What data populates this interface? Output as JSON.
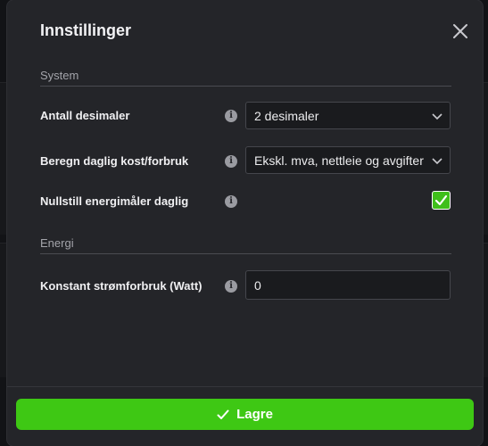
{
  "modal": {
    "title": "Innstillinger",
    "close_label": "×"
  },
  "sections": {
    "system": "System",
    "energy": "Energi"
  },
  "settings": {
    "decimals": {
      "label": "Antall desimaler",
      "value": "2 desimaler"
    },
    "daily_cost": {
      "label": "Beregn daglig kost/forbruk",
      "value": "Ekskl. mva, nettleie og avgifter"
    },
    "reset_meter": {
      "label": "Nullstill energimåler daglig",
      "checked": true
    },
    "constant_power": {
      "label": "Konstant strømforbruk (Watt)",
      "value": "0"
    }
  },
  "footer": {
    "save_label": "Lagre"
  },
  "icons": {
    "info": "info-icon",
    "close": "close-icon",
    "chevron": "chevron-down-icon",
    "check": "check-icon"
  },
  "colors": {
    "accent": "#3ec814",
    "modal_bg": "#242529",
    "input_bg": "#1a1b1e"
  }
}
